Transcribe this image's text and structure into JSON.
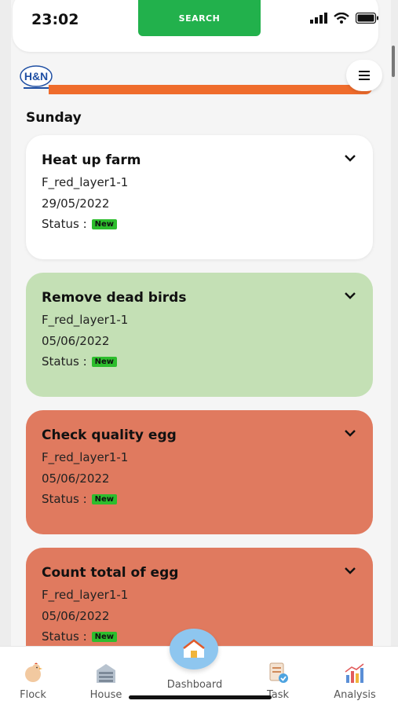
{
  "status_bar": {
    "time": "23:02"
  },
  "header": {
    "search_label": "SEARCH",
    "logo_text": "H&N"
  },
  "section": {
    "day": "Sunday"
  },
  "tasks": [
    {
      "title": "Heat up farm",
      "flock": "F_red_layer1-1",
      "date": "29/05/2022",
      "status_label": "Status :",
      "status": "New",
      "color": "#ffffff"
    },
    {
      "title": "Remove dead birds",
      "flock": "F_red_layer1-1",
      "date": "05/06/2022",
      "status_label": "Status :",
      "status": "New",
      "color": "#c4e0b5"
    },
    {
      "title": "Check quality egg",
      "flock": "F_red_layer1-1",
      "date": "05/06/2022",
      "status_label": "Status :",
      "status": "New",
      "color": "#e07a5f"
    },
    {
      "title": "Count total of egg",
      "flock": "F_red_layer1-1",
      "date": "05/06/2022",
      "status_label": "Status :",
      "status": "New",
      "color": "#e07a5f"
    }
  ],
  "nav": {
    "flock": "Flock",
    "house": "House",
    "dashboard": "Dashboard",
    "task": "Task",
    "analysis": "Analysis"
  },
  "colors": {
    "accent_green": "#22b14c",
    "accent_orange": "#ef6c2c",
    "badge_green": "#2dbd2d"
  }
}
